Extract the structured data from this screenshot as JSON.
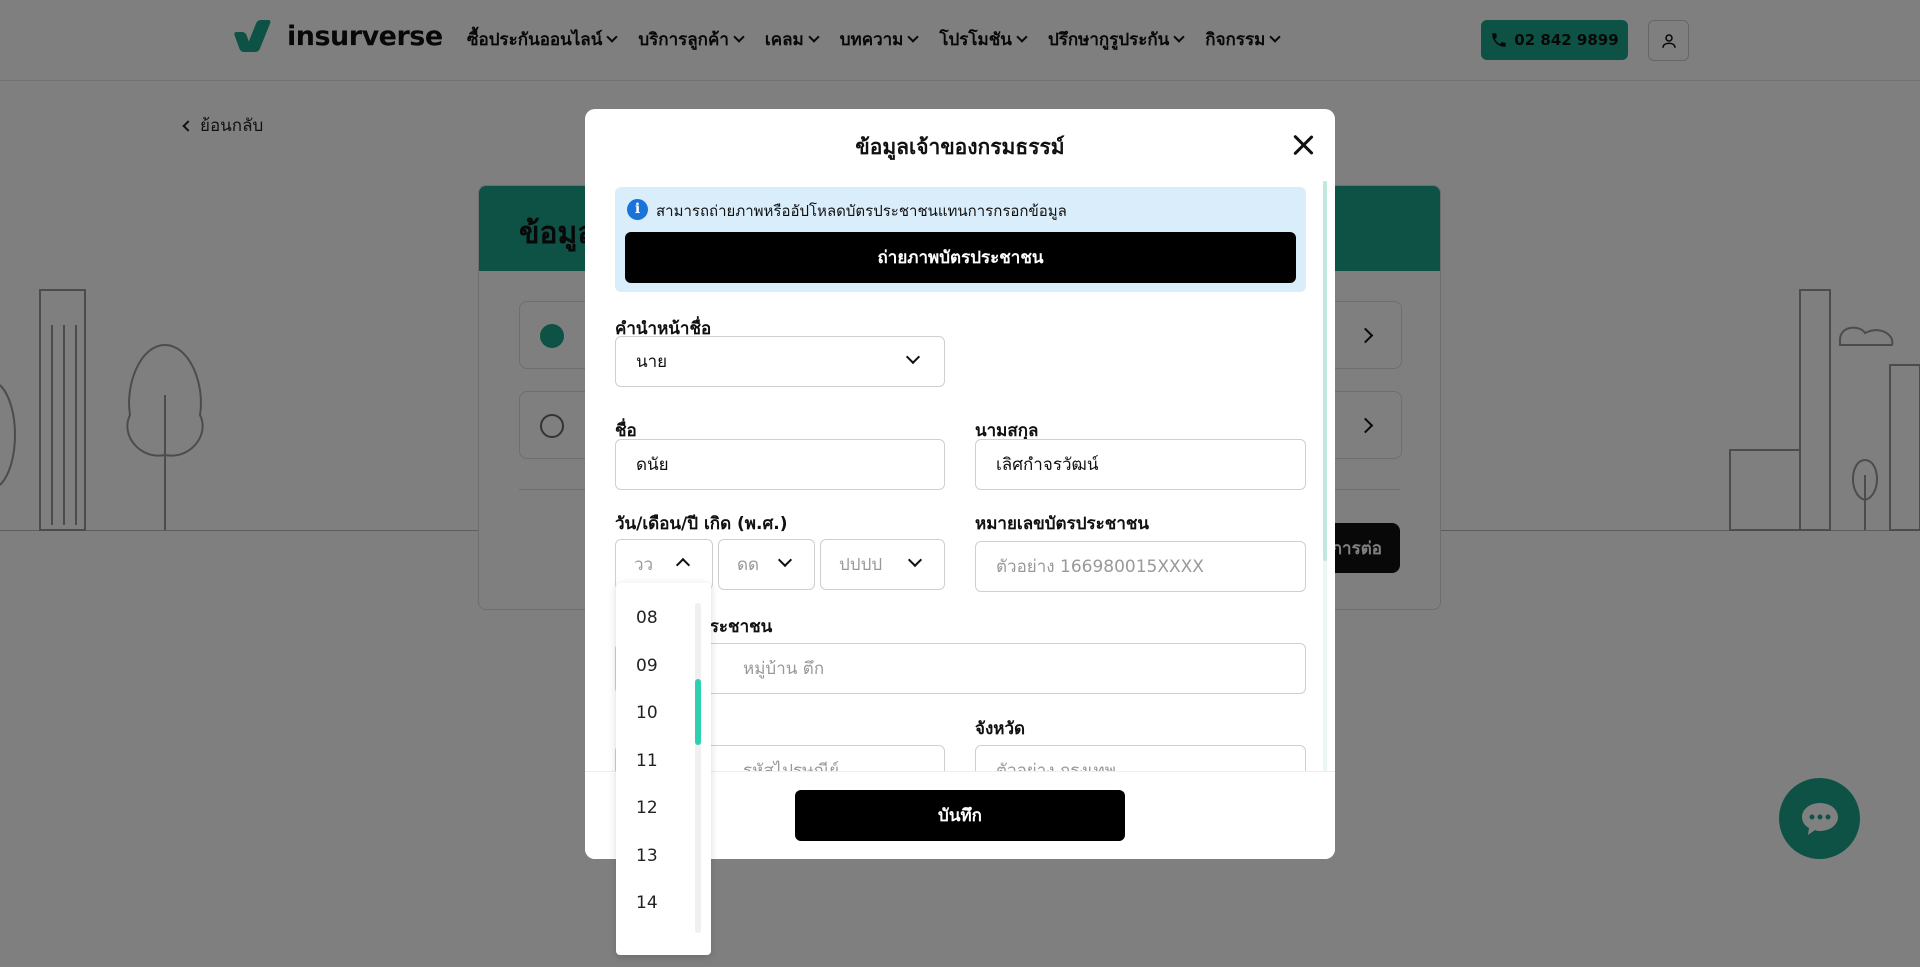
{
  "header": {
    "logo_text": "insurverse",
    "nav": [
      "ซื้อประกันออนไลน์",
      "บริการลูกค้า",
      "เคลม",
      "บทความ",
      "โปรโมชัน",
      "ปรึกษากูรูประกัน",
      "กิจกรรม"
    ],
    "phone": "02 842 9899",
    "icons": {
      "phone": "phone-icon",
      "user": "user-icon"
    }
  },
  "page": {
    "back_label": "ย้อนกลับ",
    "card_title": "ข้อมูล",
    "continue_label": "การต่อ"
  },
  "modal": {
    "title": "ข้อมูลเจ้าของกรมธรรม์",
    "info_text": "สามารถถ่ายภาพหรืออัปโหลดบัตรประชาชนแทนการกรอกข้อมูล",
    "photo_button": "ถ่ายภาพบัตรประชาชน",
    "prefix_label": "คำนำหน้าชื่อ",
    "prefix_value": "นาย",
    "firstname_label": "ชื่อ",
    "firstname_value": "ดนัย",
    "lastname_label": "นามสกุล",
    "lastname_value": "เลิศกำจรวัฒน์",
    "dob_label": "วัน/เดือน/ปี เกิด (พ.ศ.)",
    "dob_day_placeholder": "วว",
    "dob_month_placeholder": "ดด",
    "dob_year_placeholder": "ปปปป",
    "idcard_label": "หมายเลขบัตรประชาชน",
    "idcard_placeholder": "ตัวอย่าง 166980015XXXX",
    "address_label_partial": "ประชาชน",
    "address_placeholder_partial": "หมู่บ้าน ตึก",
    "district_label_partial": "ี",
    "district_placeholder_partial": "รหัสไปรษณีย์",
    "province_label": "จังหวัด",
    "province_placeholder": "ตัวอย่าง กรุงเทพ",
    "save_button": "บันทึก"
  },
  "day_dropdown": {
    "options": [
      "08",
      "09",
      "10",
      "11",
      "12",
      "13",
      "14"
    ]
  },
  "colors": {
    "brand": "#1aa48a",
    "info_bg": "#d9edfb",
    "scroll_thumb": "#2fd0b0"
  }
}
